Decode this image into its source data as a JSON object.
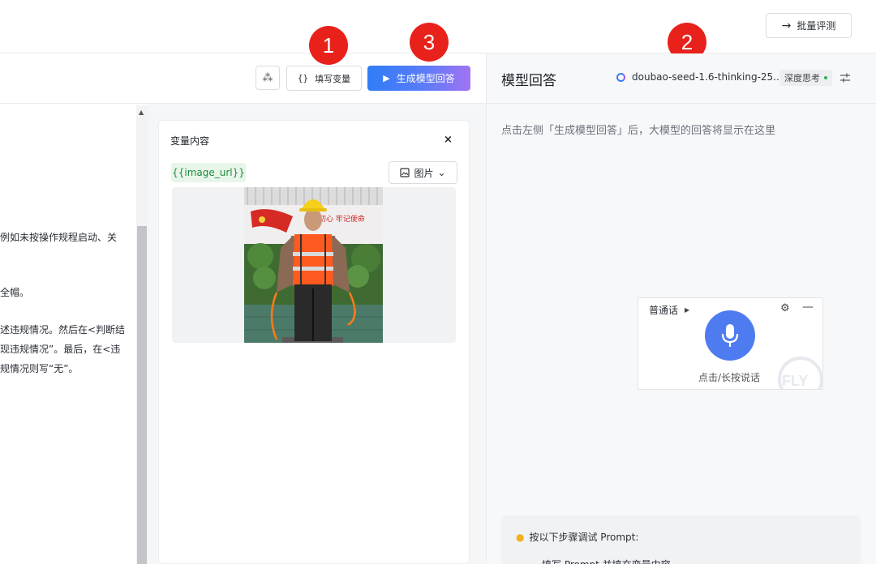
{
  "topbar": {
    "batch_label": "批量评测",
    "batch_icon": "arrow-right-icon"
  },
  "toolbar": {
    "fill_vars_brace": "{}",
    "fill_vars_label": "填写变量",
    "generate_label": "生成模型回答"
  },
  "annotations": [
    "1",
    "2",
    "3"
  ],
  "editor": {
    "lines": [
      "例如未按操作规程启动、关",
      "全帽。",
      "述违规情况。然后在<判断结",
      "现违规情况”。最后，在<违",
      "规情况则写“无”。"
    ]
  },
  "variables": {
    "title": "变量内容",
    "close": "×",
    "tag": "{{image_url}}",
    "type_label": "图片",
    "photo_sign": "初心 牢记使命"
  },
  "response": {
    "title": "模型回答",
    "model_name": "doubao-seed-1.6-thinking-25...",
    "deep_think": "深度思考",
    "placeholder": "点击左侧「生成模型回答」后，大模型的回答将显示在这里"
  },
  "voice": {
    "language": "普通话",
    "hint": "点击/长按说话",
    "watermark": "iFLY"
  },
  "tips": {
    "title": "按以下步骤调试 Prompt:",
    "step1": "填写 Prompt 并填充变量内容"
  },
  "colors": {
    "primary": "#2f7df6",
    "gradient_end": "#a173f3",
    "badge_red": "#e8221b",
    "tag_green": "#1f8a3d",
    "mic_blue": "#4e7cf0"
  }
}
